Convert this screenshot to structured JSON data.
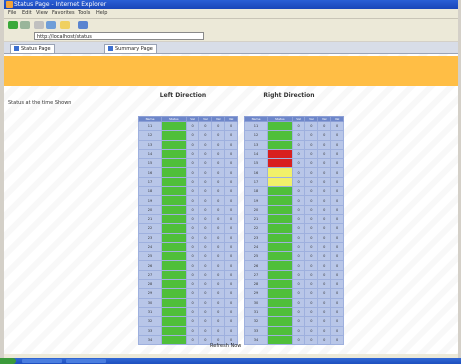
{
  "window": {
    "title": "Status Page - Internet Explorer"
  },
  "menu": [
    "File",
    "Edit",
    "View",
    "Favorites",
    "Tools",
    "Help"
  ],
  "address": {
    "value": "http://localhost/status"
  },
  "tabs": [
    {
      "label": "Status Page"
    },
    {
      "label": "Summary Page"
    }
  ],
  "page": {
    "banner_color": "#ffbe45",
    "side_note": "Status at the time Shown",
    "left_panel_title": "Left Direction",
    "right_panel_title": "Right Direction",
    "table_headers": [
      "Name",
      "Status",
      "Val",
      "Val",
      "Val",
      "Val"
    ],
    "left_rows": [
      [
        "11",
        "",
        "0",
        "0",
        "0",
        "0"
      ],
      [
        "12",
        "",
        "0",
        "0",
        "0",
        "0"
      ],
      [
        "13",
        "",
        "0",
        "0",
        "0",
        "0"
      ],
      [
        "14",
        "",
        "0",
        "0",
        "0",
        "0"
      ],
      [
        "15",
        "",
        "0",
        "0",
        "0",
        "0"
      ],
      [
        "16",
        "",
        "0",
        "0",
        "0",
        "0"
      ],
      [
        "17",
        "",
        "0",
        "0",
        "0",
        "0"
      ],
      [
        "18",
        "",
        "0",
        "0",
        "0",
        "0"
      ],
      [
        "19",
        "",
        "0",
        "0",
        "0",
        "0"
      ],
      [
        "20",
        "",
        "0",
        "0",
        "0",
        "0"
      ],
      [
        "21",
        "",
        "0",
        "0",
        "0",
        "0"
      ],
      [
        "22",
        "",
        "0",
        "0",
        "0",
        "0"
      ],
      [
        "23",
        "",
        "0",
        "0",
        "0",
        "0"
      ],
      [
        "24",
        "",
        "0",
        "0",
        "0",
        "0"
      ],
      [
        "25",
        "",
        "0",
        "0",
        "0",
        "0"
      ],
      [
        "26",
        "",
        "0",
        "0",
        "0",
        "0"
      ],
      [
        "27",
        "",
        "0",
        "0",
        "0",
        "0"
      ],
      [
        "28",
        "",
        "0",
        "0",
        "0",
        "0"
      ],
      [
        "29",
        "",
        "0",
        "0",
        "0",
        "0"
      ],
      [
        "30",
        "",
        "0",
        "0",
        "0",
        "0"
      ],
      [
        "31",
        "",
        "0",
        "0",
        "0",
        "0"
      ],
      [
        "32",
        "",
        "0",
        "0",
        "0",
        "0"
      ],
      [
        "33",
        "",
        "0",
        "0",
        "0",
        "0"
      ],
      [
        "34",
        "",
        "0",
        "0",
        "0",
        "0"
      ]
    ],
    "right_rows": [
      [
        "11",
        "",
        "0",
        "0",
        "0",
        "0"
      ],
      [
        "12",
        "",
        "0",
        "0",
        "0",
        "0"
      ],
      [
        "13",
        "",
        "0",
        "0",
        "0",
        "0"
      ],
      [
        "14",
        "",
        "0",
        "0",
        "0",
        "0"
      ],
      [
        "15",
        "",
        "0",
        "0",
        "0",
        "0"
      ],
      [
        "16",
        "",
        "0",
        "0",
        "0",
        "0"
      ],
      [
        "17",
        "",
        "0",
        "0",
        "0",
        "0"
      ],
      [
        "18",
        "",
        "0",
        "0",
        "0",
        "0"
      ],
      [
        "19",
        "",
        "0",
        "0",
        "0",
        "0"
      ],
      [
        "20",
        "",
        "0",
        "0",
        "0",
        "0"
      ],
      [
        "21",
        "",
        "0",
        "0",
        "0",
        "0"
      ],
      [
        "22",
        "",
        "0",
        "0",
        "0",
        "0"
      ],
      [
        "23",
        "",
        "0",
        "0",
        "0",
        "0"
      ],
      [
        "24",
        "",
        "0",
        "0",
        "0",
        "0"
      ],
      [
        "25",
        "",
        "0",
        "0",
        "0",
        "0"
      ],
      [
        "26",
        "",
        "0",
        "0",
        "0",
        "0"
      ],
      [
        "27",
        "",
        "0",
        "0",
        "0",
        "0"
      ],
      [
        "28",
        "",
        "0",
        "0",
        "0",
        "0"
      ],
      [
        "29",
        "",
        "0",
        "0",
        "0",
        "0"
      ],
      [
        "30",
        "",
        "0",
        "0",
        "0",
        "0"
      ],
      [
        "31",
        "",
        "0",
        "0",
        "0",
        "0"
      ],
      [
        "32",
        "",
        "0",
        "0",
        "0",
        "0"
      ],
      [
        "33",
        "",
        "0",
        "0",
        "0",
        "0"
      ],
      [
        "34",
        "",
        "0",
        "0",
        "0",
        "0"
      ]
    ],
    "right_status_colors": {
      "3": "red",
      "4": "red",
      "5": "yellow",
      "6": "yellow"
    },
    "footer_link": "Refresh Now"
  },
  "colors": {
    "status_ok": "#4fbf3a",
    "status_alarm": "#d81f1f",
    "status_warn": "#f1f06a",
    "header": "#6d86c9"
  }
}
